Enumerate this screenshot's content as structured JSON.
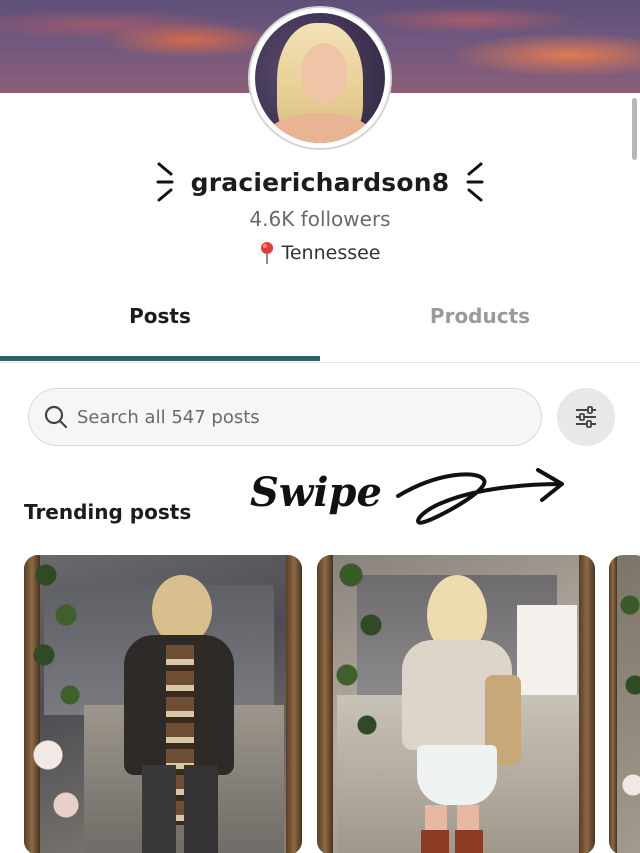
{
  "profile": {
    "username": "gracierichardson8",
    "followers": "4.6K followers",
    "location": "Tennessee"
  },
  "tabs": [
    {
      "label": "Posts",
      "active": true
    },
    {
      "label": "Products",
      "active": false
    }
  ],
  "search": {
    "placeholder": "Search all 547 posts"
  },
  "section": {
    "title": "Trending posts",
    "swipe_label": "Swipe"
  },
  "colors": {
    "tab_indicator": "#2f5f66",
    "text_primary": "#1c1c1c",
    "text_secondary": "#6a6a6a"
  },
  "icons": [
    "search-icon",
    "filter-icon",
    "location-pin-icon",
    "swipe-arrow-icon"
  ]
}
